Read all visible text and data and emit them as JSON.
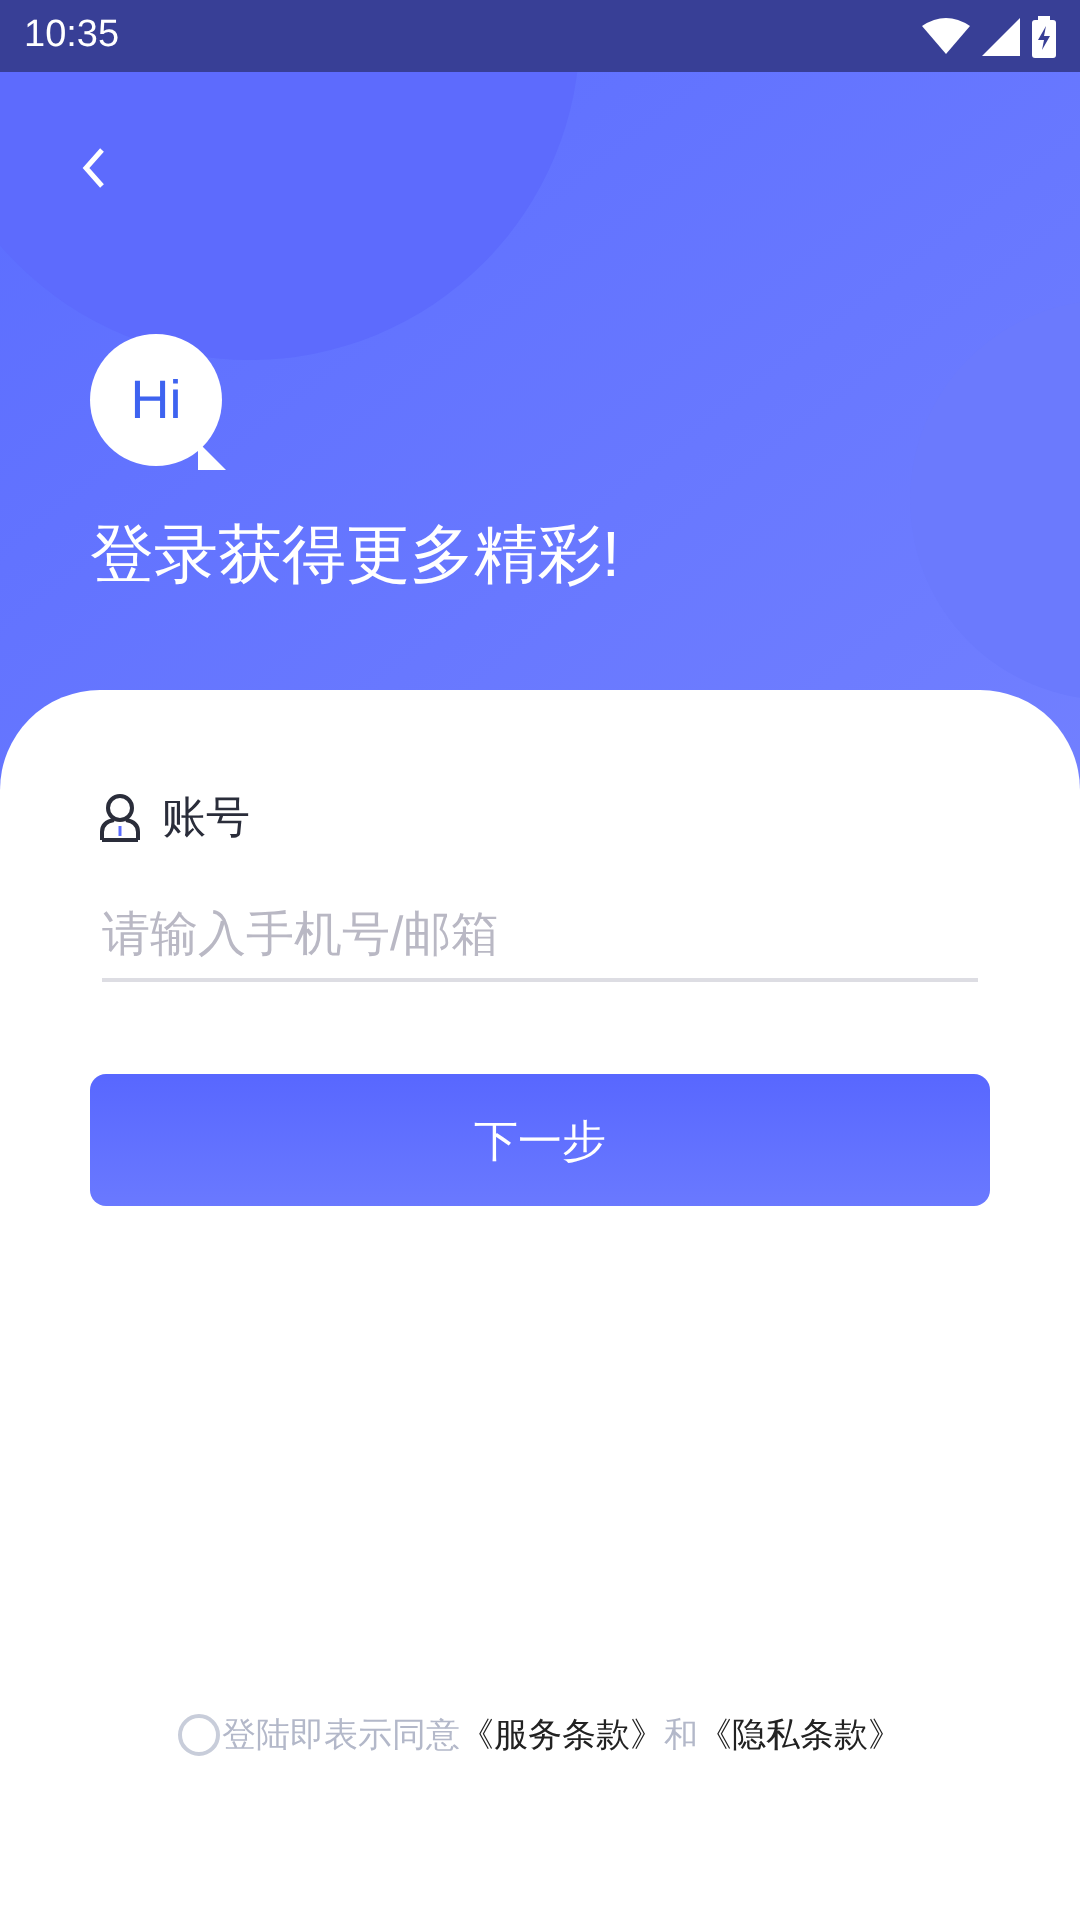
{
  "status_bar": {
    "time": "10:35"
  },
  "header": {
    "greeting_badge": "Hi",
    "title": "登录获得更多精彩!"
  },
  "form": {
    "account_label": "账号",
    "account_field": {
      "placeholder": "请输入手机号/邮箱"
    },
    "next_button": "下一步"
  },
  "agreement": {
    "checked": false,
    "prefix": "登陆即表示同意",
    "terms_link": "《服务条款》",
    "connector": "和",
    "privacy_link": "《隐私条款》"
  }
}
